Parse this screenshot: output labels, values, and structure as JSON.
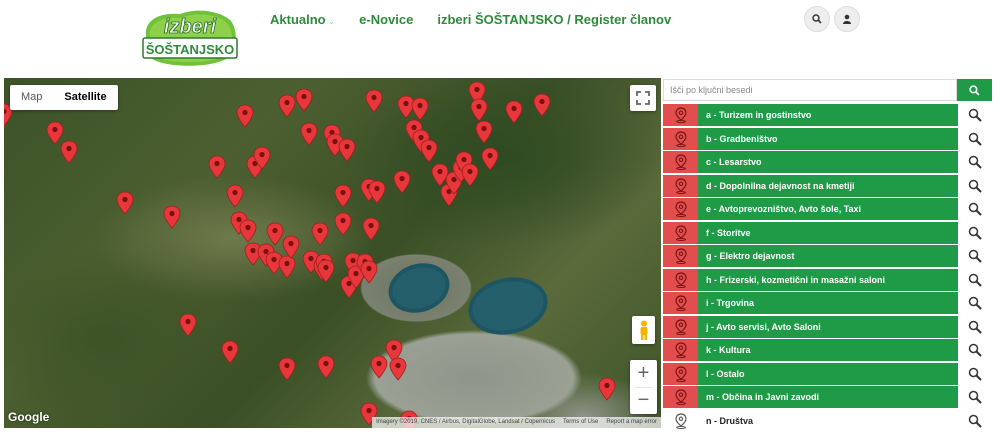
{
  "header": {
    "logo_line1": "izberi",
    "logo_line2": "ŠOŠTANJSKO",
    "nav": [
      {
        "label": "Aktualno",
        "has_dropdown": true
      },
      {
        "label": "e-Novice",
        "has_dropdown": false
      },
      {
        "label": "izberi ŠOŠTANJSKO / Register članov",
        "has_dropdown": false
      }
    ],
    "caret": "⌄",
    "search_icon": "search-icon",
    "user_icon": "user-icon"
  },
  "map": {
    "type_buttons": [
      {
        "label": "Map",
        "active": false
      },
      {
        "label": "Satellite",
        "active": true
      }
    ],
    "zoom_in": "+",
    "zoom_out": "−",
    "google_logo": "Google",
    "attribution": [
      "Imagery ©2019, CNES / Airbus, DigitalGlobe, Landsat / Copernicus",
      "Terms of Use",
      "Report a map error"
    ]
  },
  "sidebar": {
    "search_placeholder": "Išči po ključni besedi",
    "categories": [
      {
        "label": "a - Turizem in gostinstvo",
        "style": "red"
      },
      {
        "label": "b - Gradbeništvo",
        "style": "red"
      },
      {
        "label": "c - Lesarstvo",
        "style": "red"
      },
      {
        "label": "d - Dopolnilna dejavnost na kmetiji",
        "style": "red"
      },
      {
        "label": "e - Avtoprevozništvo, Avto šole, Taxi",
        "style": "red"
      },
      {
        "label": "f - Storitve",
        "style": "red"
      },
      {
        "label": "g - Elektro dejavnost",
        "style": "red"
      },
      {
        "label": "h - Frizerski, kozmetični in masažni saloni",
        "style": "red"
      },
      {
        "label": "i - Trgovina",
        "style": "red"
      },
      {
        "label": "j - Avto servisi, Avto Saloni",
        "style": "red"
      },
      {
        "label": "k - Kultura",
        "style": "red"
      },
      {
        "label": "l - Ostalo",
        "style": "red"
      },
      {
        "label": "m - Občina in Javni zavodi",
        "style": "red"
      },
      {
        "label": "n - Društva",
        "style": "white"
      }
    ]
  },
  "colors": {
    "brand_green": "#1f9b47",
    "nav_green": "#2e8b3a",
    "pin_red": "#e24e4e",
    "marker_red": "#e8373a"
  }
}
